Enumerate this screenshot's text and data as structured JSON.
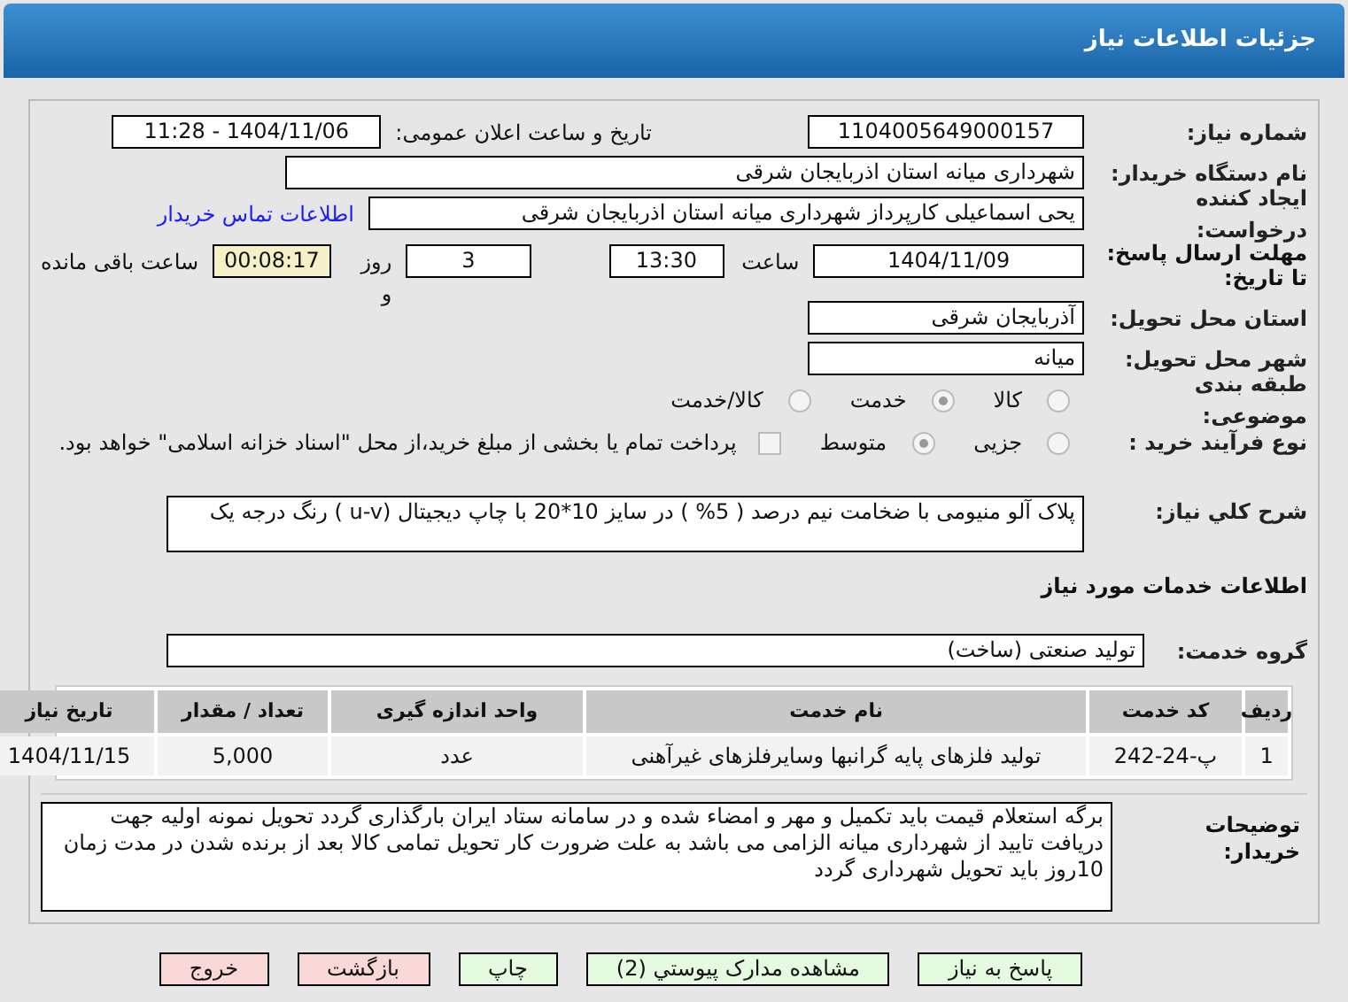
{
  "header": {
    "title": "جزئیات اطلاعات نیاز"
  },
  "need_number": {
    "label": "شماره نیاز:",
    "value": "1104005649000157"
  },
  "announce": {
    "label": "تاریخ و ساعت اعلان عمومی:",
    "value": "1404/11/06 - 11:28"
  },
  "buyer": {
    "label": "نام دستگاه خریدار:",
    "value": "شهرداری میانه استان اذربایجان شرقی"
  },
  "creator": {
    "label": "ایجاد کننده درخواست:",
    "value": "یحی اسماعیلی  کارپرداز شهرداری میانه استان اذربایجان شرقی",
    "link": "اطلاعات تماس خریدار"
  },
  "deadline": {
    "label": "مهلت ارسال پاسخ: تا تاریخ:",
    "date": "1404/11/09",
    "time_label": "ساعت",
    "time": "13:30",
    "days": "3",
    "days_label": "روز و",
    "remaining": "00:08:17",
    "remaining_label": "ساعت باقی مانده"
  },
  "province": {
    "label": "استان محل تحویل:",
    "value": "آذربایجان شرقی"
  },
  "city": {
    "label": "شهر محل تحویل:",
    "value": "میانه"
  },
  "category": {
    "label": "طبقه بندی موضوعی:",
    "options": [
      {
        "label": "کالا",
        "selected": false
      },
      {
        "label": "خدمت",
        "selected": true
      },
      {
        "label": "کالا/خدمت",
        "selected": false
      }
    ]
  },
  "process": {
    "label": "نوع فرآیند خرید :",
    "options": [
      {
        "kind": "radio",
        "label": "جزیی",
        "selected": false
      },
      {
        "kind": "radio",
        "label": "متوسط",
        "selected": true
      },
      {
        "kind": "checkbox",
        "label": "پرداخت تمام یا بخشی از مبلغ خرید،از محل \"اسناد خزانه اسلامی\" خواهد بود.",
        "checked": false
      }
    ]
  },
  "description": {
    "label": "شرح کلي نياز:",
    "value": "پلاک آلو منیومی با ضخامت نیم درصد ( 5% ) در سایز 10*20 با چاپ دیجیتال (u-v  ) رنگ درجه یک"
  },
  "services_heading": "اطلاعات خدمات مورد نیاز",
  "service_group": {
    "label": "گروه خدمت:",
    "value": "تولید صنعتی (ساخت)"
  },
  "table": {
    "columns": [
      "ردیف",
      "کد خدمت",
      "نام خدمت",
      "واحد اندازه گیری",
      "تعداد / مقدار",
      "تاریخ نیاز"
    ],
    "rows": [
      [
        "1",
        "پ-24-242",
        "تولید فلزهای پایه گرانبها وسایرفلزهای غیرآهنی",
        "عدد",
        "5,000",
        "1404/11/15"
      ]
    ]
  },
  "notes": {
    "label": "توضیحات خریدار:",
    "value": "برگه استعلام قیمت باید تکمیل و مهر و امضاء شده و در سامانه ستاد ایران بارگذاری گردد تحویل نمونه اولیه جهت دریافت تایید از شهرداری میانه الزامی می باشد به علت ضرورت کار تحویل تمامی کالا بعد از برنده شدن در مدت زمان 10روز باید تحویل شهرداری گردد"
  },
  "buttons": [
    {
      "label": "پاسخ به نیاز",
      "kind": "primary"
    },
    {
      "label": "مشاهده مدارک پیوستي (2)",
      "kind": "primary"
    },
    {
      "label": "چاپ",
      "kind": "primary"
    },
    {
      "label": "بازگشت",
      "kind": "danger"
    },
    {
      "label": "خروج",
      "kind": "danger"
    }
  ]
}
